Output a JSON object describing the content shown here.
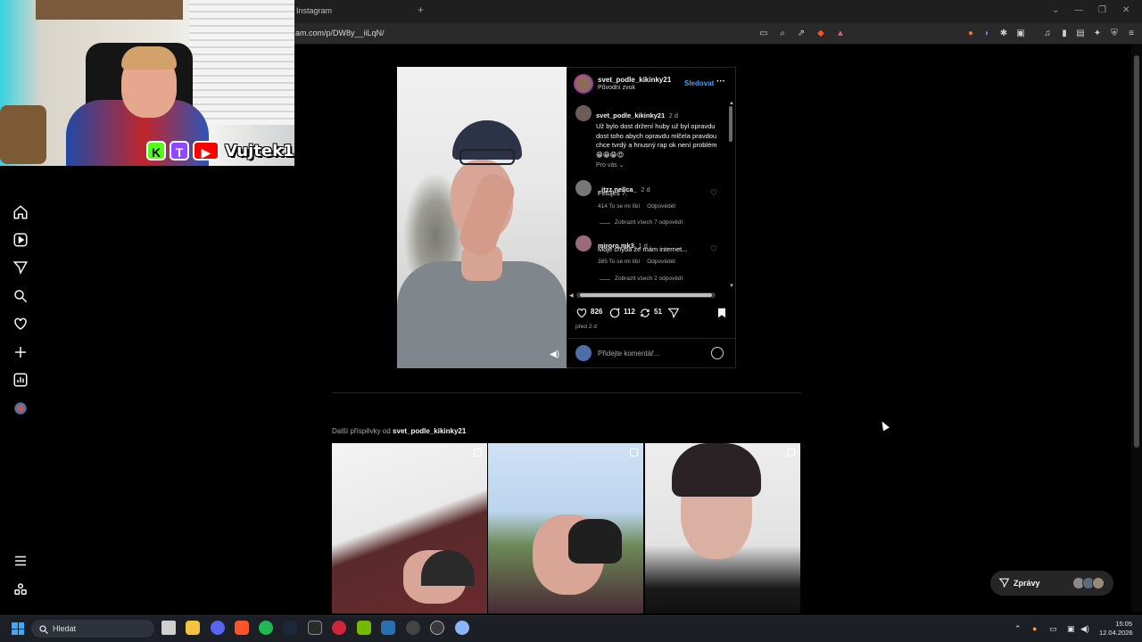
{
  "browser": {
    "tab_title": "Instagram",
    "new_tab_symbol": "+",
    "url": "am.com/p/DW8y__iiLqN/",
    "window_controls": [
      "⌄",
      "—",
      "❐",
      "✕"
    ],
    "toolbar_icons": [
      "reader-mode-icon",
      "zoom-icon",
      "share-icon",
      "brave-shield-icon",
      "brave-rewards-icon",
      "extension-icon",
      "extension-icon",
      "extensions-puzzle-icon",
      "tab-icon",
      "music-icon",
      "sidebar-icon",
      "wallet-icon",
      "ai-icon",
      "vpn-icon",
      "menu-icon"
    ]
  },
  "webcam": {
    "streamer_name": "Vujtek1",
    "badges": [
      "K",
      "T",
      "▶"
    ]
  },
  "sidebar": {
    "items": [
      {
        "name": "home-icon"
      },
      {
        "name": "reels-icon"
      },
      {
        "name": "direct-icon"
      },
      {
        "name": "search-icon"
      },
      {
        "name": "notifications-icon"
      },
      {
        "name": "create-icon"
      },
      {
        "name": "dashboard-icon"
      },
      {
        "name": "profile-avatar"
      }
    ],
    "bottom": [
      {
        "name": "menu-icon"
      },
      {
        "name": "meta-icon"
      }
    ]
  },
  "post": {
    "username": "svet_podle_kikinky21",
    "audio": "Původní zvuk",
    "follow_label": "Sledovat",
    "more_label": "···",
    "caption": {
      "username": "svet_podle_kikinky21",
      "age": "2 d",
      "text": "Už bylo dost držení huby už byl opravdu dost toho abych opravdu mlčela pravdou chce tvrdý a hnusný rap ok není problém 😁😁😁😍"
    },
    "for_you_label": "Pro vás ⌄",
    "comments": [
      {
        "username": "_itzz.nellca_",
        "age": "2 d",
        "text": "Fetuješ ?.",
        "likes": "414 To se mi líbí",
        "reply_label": "Odpovědět",
        "show_replies": "Zobrazit všech 7 odpovědí"
      },
      {
        "username": "miroro.mk3",
        "age": "1 d",
        "text": "Moje chyba že mám internet...",
        "likes": "385 To se mi líbí",
        "reply_label": "Odpovědět",
        "show_replies": "Zobrazit všech 2 odpovědí"
      }
    ],
    "actions": {
      "likes": "826",
      "comments": "112",
      "reposts": "51"
    },
    "posted_ago": "před 2 d",
    "comment_placeholder": "Přidejte komentář..."
  },
  "more_posts": {
    "prefix": "Další příspěvky od",
    "username": "svet_podle_kikinky21"
  },
  "messages_button": {
    "label": "Zprávy"
  },
  "taskbar": {
    "search_placeholder": "Hledat",
    "apps": [
      "task-view",
      "file-explorer",
      "discord",
      "brave",
      "spotify",
      "steam",
      "epic-games",
      "app-red",
      "nvidia",
      "steam-alt",
      "app-g",
      "obs",
      "settings"
    ],
    "time": "15:05",
    "date": "12.04.2026",
    "colors": {
      "start": "#3fa9f5",
      "background": "#1c1f26"
    }
  },
  "colors": {
    "instagram_blue": "#4a9eff",
    "background": "#000000",
    "panel_border": "#262626"
  }
}
